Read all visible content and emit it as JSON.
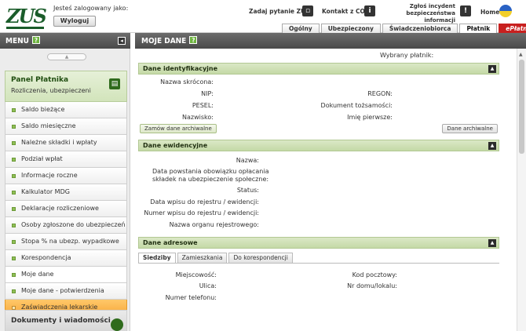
{
  "header": {
    "logo_text": "ZUS",
    "logged_as": "Jesteś zalogowany jako:",
    "logout": "Wyloguj",
    "ask_zus": "Zadaj pytanie ZUS",
    "contact_cot": "Kontakt z COT",
    "incident_line1": "Zgłoś incydent",
    "incident_line2": "bezpieczeństwa informacji",
    "home": "Home"
  },
  "tabs": [
    {
      "label": "Ogólny"
    },
    {
      "label": "Ubezpieczony"
    },
    {
      "label": "Świadczeniobiorca"
    },
    {
      "label": "Płatnik"
    },
    {
      "label": "ePłatnik"
    }
  ],
  "menu": {
    "title": "MENU",
    "help": "?",
    "panel_title": "Panel Płatnika",
    "panel_sub": "Rozliczenia, ubezpieczeni",
    "items": [
      {
        "label": "Saldo bieżące"
      },
      {
        "label": "Saldo miesięczne"
      },
      {
        "label": "Należne składki i wpłaty"
      },
      {
        "label": "Podział wpłat"
      },
      {
        "label": "Informacje roczne"
      },
      {
        "label": "Kalkulator MDG"
      },
      {
        "label": "Deklaracje rozliczeniowe"
      },
      {
        "label": "Osoby zgłoszone do ubezpieczeń"
      },
      {
        "label": "Stopa % na ubezp. wypadkowe"
      },
      {
        "label": "Korespondencja"
      },
      {
        "label": "Moje dane"
      },
      {
        "label": "Moje dane - potwierdzenia"
      },
      {
        "label": "Zaświadczenia lekarskie"
      }
    ],
    "docs_title": "Dokumenty i wiadomości"
  },
  "main": {
    "title": "MOJE DANE",
    "help": "?",
    "wybrany_platnik": "Wybrany płatnik:",
    "dane_identyfikacyjne": {
      "title": "Dane identyfikacyjne",
      "nazwa_skrocona": "Nazwa skrócona:",
      "nip": "NIP:",
      "regon": "REGON:",
      "pesel": "PESEL:",
      "dokument": "Dokument tożsamości:",
      "nazwisko": "Nazwisko:",
      "imie": "Imię pierwsze:",
      "btn_zamow": "Zamów dane archiwalne",
      "btn_archiwalne": "Dane archiwalne"
    },
    "dane_ewidencyjne": {
      "title": "Dane ewidencyjne",
      "nazwa": "Nazwa:",
      "data_powstania_1": "Data powstania obowiązku opłacania",
      "data_powstania_2": "składek na ubezpieczenie społeczne:",
      "status": "Status:",
      "data_wpisu": "Data wpisu do rejestru / ewidencji:",
      "numer_wpisu": "Numer wpisu do rejestru / ewidencji:",
      "nazwa_organu": "Nazwa organu rejestrowego:"
    },
    "dane_adresowe": {
      "title": "Dane adresowe",
      "tabs": [
        {
          "label": "Siedziby"
        },
        {
          "label": "Zamieszkania"
        },
        {
          "label": "Do korespondencji"
        }
      ],
      "miejscowosc": "Miejscowość:",
      "kod": "Kod pocztowy:",
      "ulica": "Ulica:",
      "nr_domu": "Nr domu/lokalu:",
      "telefon": "Numer telefonu:"
    }
  }
}
